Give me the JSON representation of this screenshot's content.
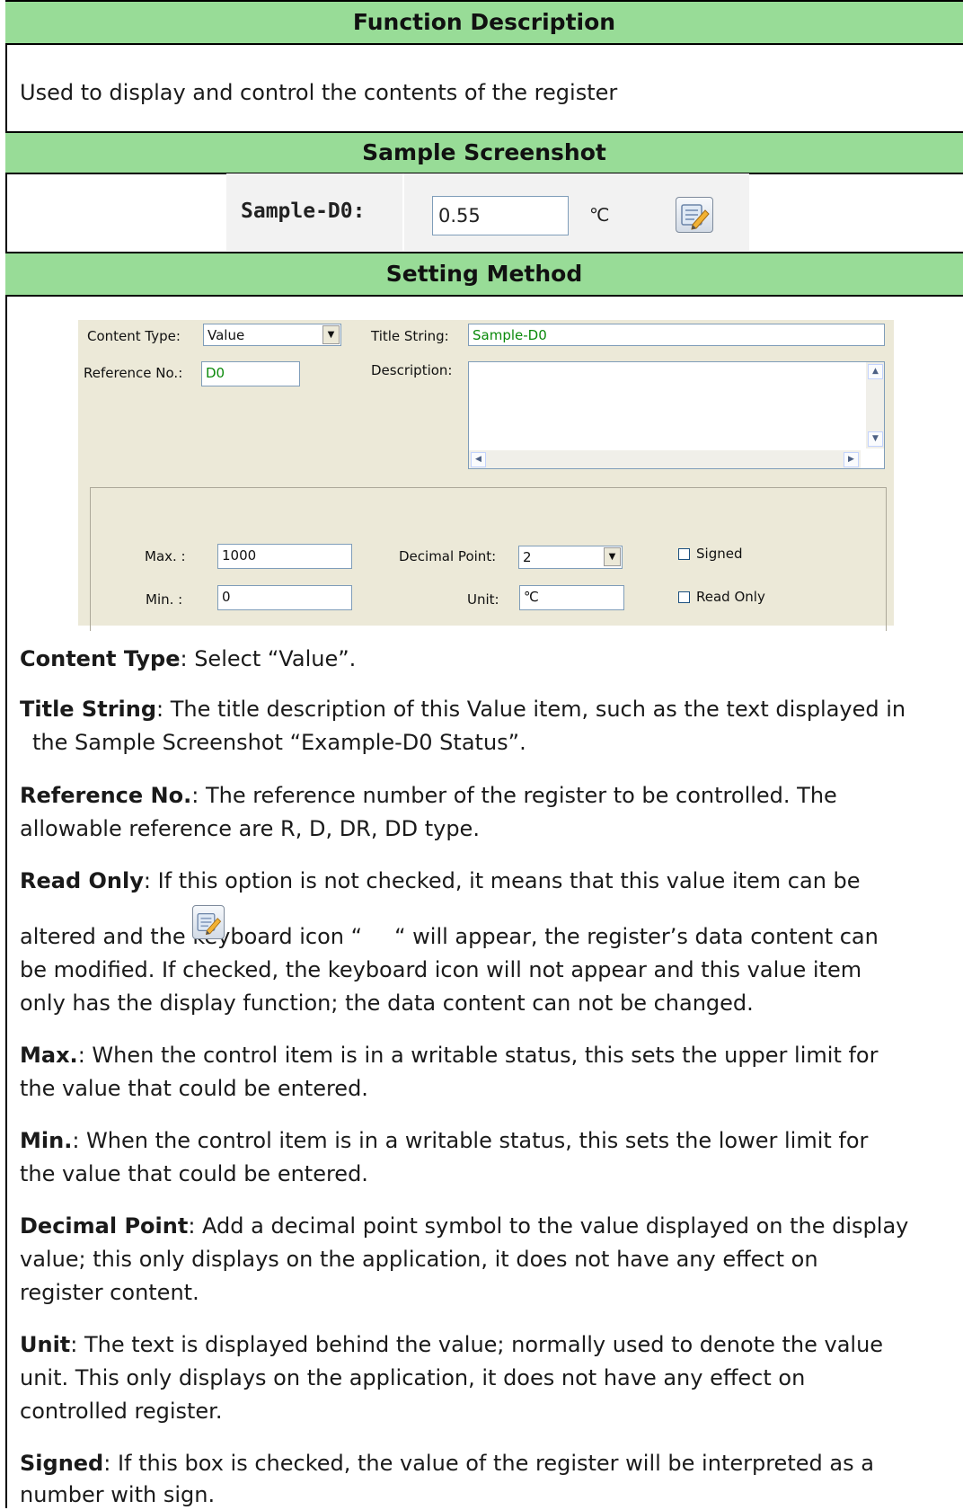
{
  "headers": {
    "function_description": "Function Description",
    "sample_screenshot": "Sample Screenshot",
    "setting_method": "Setting Method"
  },
  "function_text": "Used to display and control the contents of the register",
  "sample": {
    "title": "Sample-D0:",
    "value": "0.55",
    "unit": "℃",
    "icon": "keyboard-edit-icon"
  },
  "dialog": {
    "content_type_label": "Content Type:",
    "content_type_value": "Value",
    "title_string_label": "Title String:",
    "title_string_value": "Sample-D0",
    "reference_no_label": "Reference No.:",
    "reference_no_value": "D0",
    "description_label": "Description:",
    "description_value": "",
    "max_label": "Max. :",
    "max_value": "1000",
    "min_label": "Min. :",
    "min_value": "0",
    "decimal_point_label": "Decimal Point:",
    "decimal_point_value": "2",
    "unit_label": "Unit:",
    "unit_value": "℃",
    "signed_label": "Signed",
    "signed_checked": false,
    "read_only_label": "Read Only",
    "read_only_checked": false
  },
  "descriptions": {
    "content_type": {
      "term": "Content Type",
      "text": ": Select “Value”."
    },
    "title_string": {
      "term": "Title String",
      "line1": ": The title description of this Value item, such as the text displayed in",
      "line2": "the Sample Screenshot “Example-D0 Status”."
    },
    "reference_no": {
      "term": "Reference No.",
      "line1": ": The reference number of the register to be controlled. The",
      "line2": "allowable reference are R, D, DR, DD type."
    },
    "read_only": {
      "term": "Read Only",
      "line1": ": If this option is not checked, it means that this value item can be",
      "line2_pre": "altered and the keyboard icon “",
      "line2_post": "“ will appear, the register’s data content can",
      "line3": "be modified. If checked, the keyboard icon will not appear and this value item",
      "line4": "only has the display function; the data content can not be changed."
    },
    "max": {
      "term": "Max.",
      "line1": ": When the control item is in a writable status, this sets the upper limit for",
      "line2": "the value that could be entered."
    },
    "min": {
      "term": "Min.",
      "line1": ": When the control item is in a writable status, this sets the lower limit for",
      "line2": "the value that could be entered."
    },
    "decimal_point": {
      "term": "Decimal Point",
      "line1": ": Add a decimal point symbol to the value displayed on the display",
      "line2": "value; this only displays on the application, it does not have any effect on",
      "line3": "register content."
    },
    "unit": {
      "term": "Unit",
      "line1": ": The text is displayed behind the value; normally used to denote the value",
      "line2": "unit. This only displays on the application, it does not have any effect on",
      "line3": "controlled register."
    },
    "signed": {
      "term": "Signed",
      "line1": ": If this box is checked, the value of the register will be interpreted as a",
      "line2": "number with sign."
    }
  }
}
